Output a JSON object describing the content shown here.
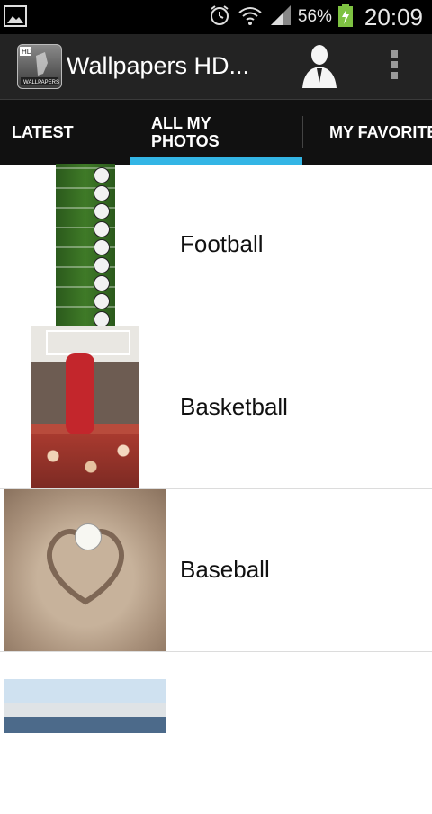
{
  "status_bar": {
    "battery_percent": "56%",
    "time": "20:09",
    "icons": [
      "image-icon",
      "alarm-icon",
      "wifi-icon",
      "signal-icon",
      "battery-charging-icon"
    ]
  },
  "action_bar": {
    "title": "Wallpapers HD...",
    "app_icon": "app-icon",
    "app_icon_text": {
      "top": "HD",
      "bottom": "WALLPAPERS"
    },
    "actions": [
      "person-icon",
      "overflow-menu-icon"
    ]
  },
  "tabs": [
    {
      "label": "LATEST"
    },
    {
      "label": "ALL MY\nPHOTOS",
      "selected": true
    },
    {
      "label": "MY FAVORITES"
    }
  ],
  "list": [
    {
      "label": "Football",
      "thumbnail": "football-thumbnail"
    },
    {
      "label": "Basketball",
      "thumbnail": "basketball-thumbnail"
    },
    {
      "label": "Baseball",
      "thumbnail": "baseball-thumbnail"
    },
    {
      "label": "",
      "thumbnail": "stadium-thumbnail"
    }
  ],
  "colors": {
    "status_bar": "#000000",
    "action_bar": "#232323",
    "tab_bar": "#111111",
    "tab_indicator": "#33b5e5",
    "row_text": "#111111"
  }
}
